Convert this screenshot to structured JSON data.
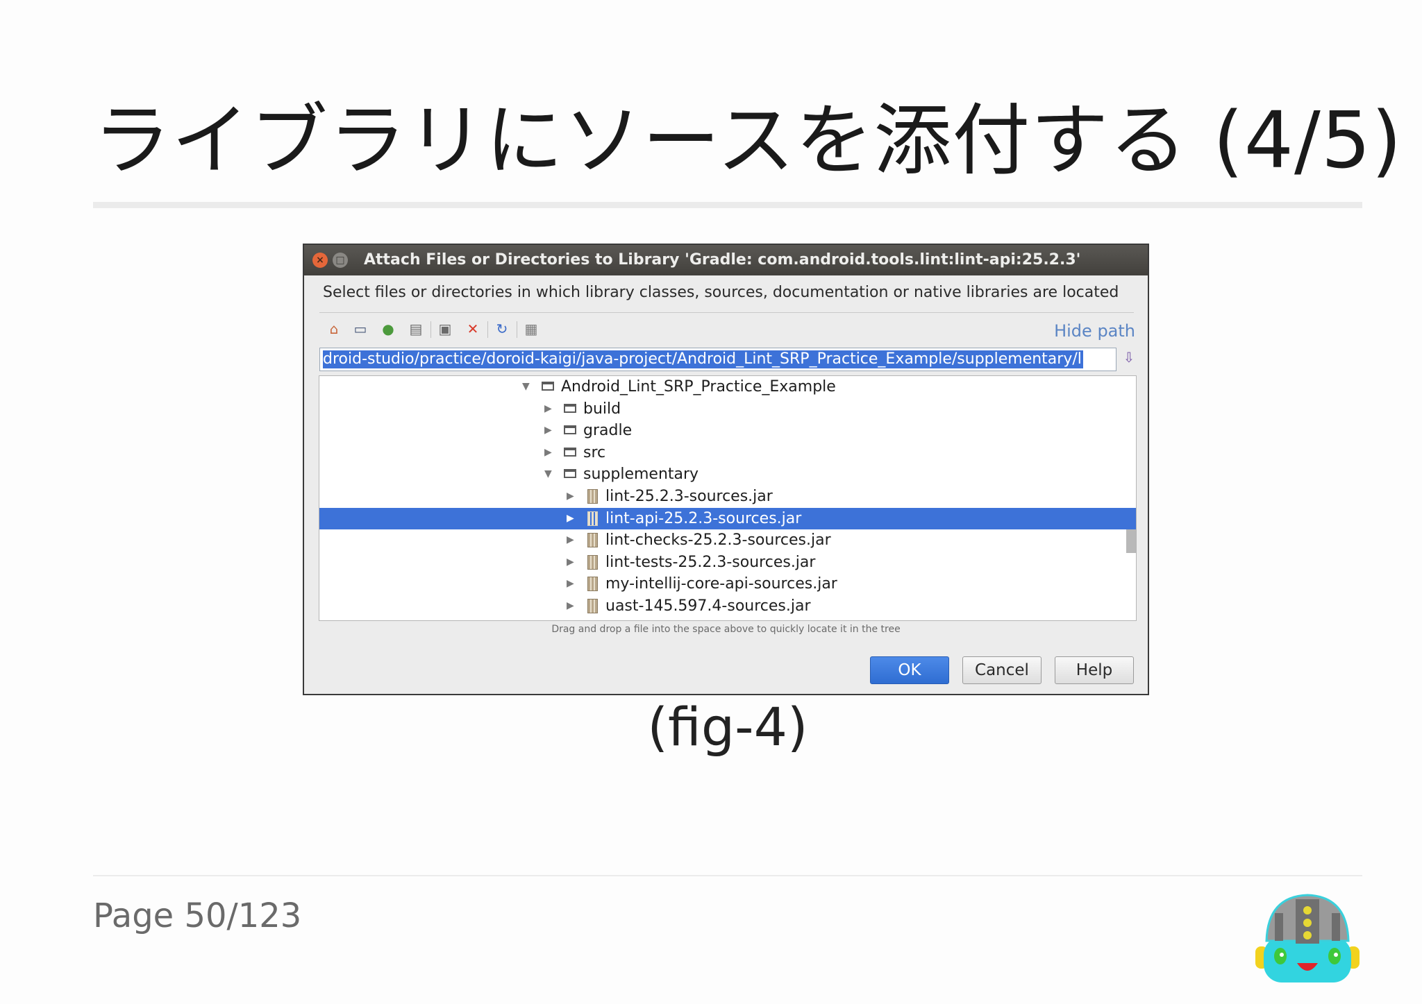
{
  "slide": {
    "title": "ライブラリにソースを添付する (4/5)",
    "caption": "(fig-4)",
    "page": "Page 50/123"
  },
  "dialog": {
    "title": "Attach Files or Directories to Library 'Gradle: com.android.tools.lint:lint-api:25.2.3'",
    "close_glyph": "×",
    "max_glyph": "□",
    "description": "Select files or directories in which library classes, sources, documentation or native libraries are located",
    "toolbar_icons": [
      "home-icon",
      "desktop-icon",
      "project-icon",
      "module-icon",
      "new-folder-icon",
      "delete-icon",
      "refresh-icon",
      "show-hidden-icon"
    ],
    "hide_path_label": "Hide path",
    "path_value": "droid-studio/practice/doroid-kaigi/java-project/Android_Lint_SRP_Practice_Example/supplementary/l",
    "tree": [
      {
        "label": "Android_Lint_SRP_Practice_Example",
        "type": "folder",
        "expanded": true,
        "depth": 0
      },
      {
        "label": "build",
        "type": "folder",
        "expanded": false,
        "depth": 1
      },
      {
        "label": "gradle",
        "type": "folder",
        "expanded": false,
        "depth": 1
      },
      {
        "label": "src",
        "type": "folder",
        "expanded": false,
        "depth": 1
      },
      {
        "label": "supplementary",
        "type": "folder",
        "expanded": true,
        "depth": 1
      },
      {
        "label": "lint-25.2.3-sources.jar",
        "type": "jar",
        "expanded": false,
        "depth": 2
      },
      {
        "label": "lint-api-25.2.3-sources.jar",
        "type": "jar",
        "expanded": false,
        "depth": 2,
        "selected": true
      },
      {
        "label": "lint-checks-25.2.3-sources.jar",
        "type": "jar",
        "expanded": false,
        "depth": 2
      },
      {
        "label": "lint-tests-25.2.3-sources.jar",
        "type": "jar",
        "expanded": false,
        "depth": 2
      },
      {
        "label": "my-intellij-core-api-sources.jar",
        "type": "jar",
        "expanded": false,
        "depth": 2
      },
      {
        "label": "uast-145.597.4-sources.jar",
        "type": "jar",
        "expanded": false,
        "depth": 2
      }
    ],
    "hint": "Drag and drop a file into the space above to quickly locate it in the tree",
    "buttons": {
      "ok": "OK",
      "cancel": "Cancel",
      "help": "Help"
    }
  },
  "colors": {
    "selection": "#3d72d8",
    "link": "#5b85c4",
    "titlebar": "#4a4845"
  }
}
